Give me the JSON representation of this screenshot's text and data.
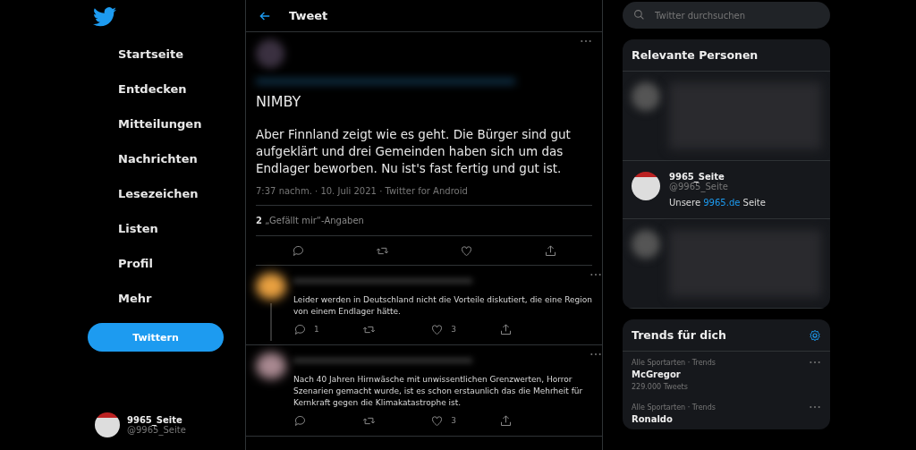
{
  "sidebar": {
    "items": [
      "Startseite",
      "Entdecken",
      "Mitteilungen",
      "Nachrichten",
      "Lesezeichen",
      "Listen",
      "Profil",
      "Mehr"
    ],
    "tweet_button": "Twittern",
    "account": {
      "name": "9965_Seite",
      "handle": "@9965_Seite"
    }
  },
  "header": {
    "title": "Tweet"
  },
  "tweet": {
    "text_lines": [
      "NIMBY",
      "Aber Finnland zeigt wie es geht. Die Bürger sind gut aufgeklärt und drei Gemeinden haben sich um das Endlager beworben. Nu ist's fast fertig und gut ist."
    ],
    "meta": "7:37 nachm. · 10. Juli 2021 · Twitter for Android",
    "likes_count": "2",
    "likes_label": "„Gefällt mir“-Angaben"
  },
  "replies": [
    {
      "text": "Leider werden in Deutschland nicht die Vorteile diskutiert, die eine Region von einem Endlager hätte.",
      "reply_count": "1",
      "like_count": "3",
      "thread_line": true
    },
    {
      "text": "Nach 40 Jahren Hirnwäsche mit unwissentlichen Grenzwerten, Horror Szenarien gemacht wurde, ist es schon erstaunlich das die Mehrheit für Kernkraft gegen die Klimakatastrophe ist.",
      "like_count": "3",
      "thread_line": false
    }
  ],
  "search": {
    "placeholder": "Twitter durchsuchen"
  },
  "relevant_people": {
    "title": "Relevante Personen",
    "person": {
      "name": "9965_Seite",
      "handle": "@9965_Seite",
      "bio_before": "Unsere ",
      "bio_link": "9965.de",
      "bio_after": " Seite"
    }
  },
  "trends": {
    "title": "Trends für dich",
    "items": [
      {
        "category": "Alle Sportarten · Trends",
        "name": "McGregor",
        "count": "229.000 Tweets"
      },
      {
        "category": "Alle Sportarten · Trends",
        "name": "Ronaldo"
      }
    ]
  }
}
